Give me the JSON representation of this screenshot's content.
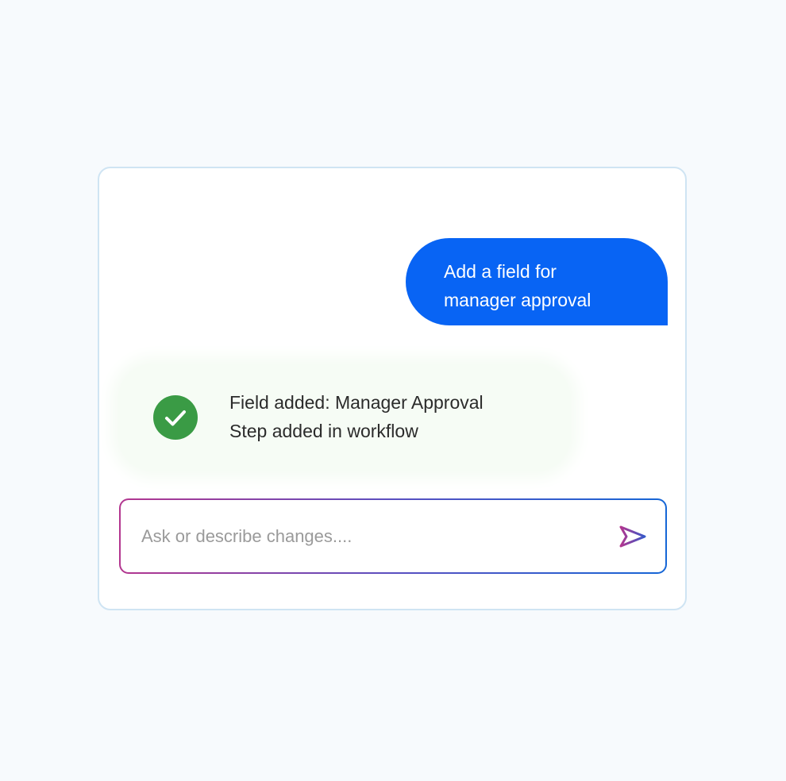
{
  "chat": {
    "user_message": {
      "line1": "Add a field for",
      "line2": "manager approval"
    },
    "assistant_reply": {
      "line1": "Field added: Manager Approval",
      "line2": "Step added in workflow",
      "status_icon": "check-circle-icon"
    }
  },
  "composer": {
    "placeholder": "Ask or describe changes....",
    "value": "",
    "send_icon": "send-icon"
  },
  "colors": {
    "page_background": "#f7fafd",
    "user_bubble": "#0864f4",
    "reply_bubble": "#f6fcf5",
    "success_green": "#3a9b45",
    "gradient_start": "#b3368f",
    "gradient_end": "#1566d6"
  }
}
